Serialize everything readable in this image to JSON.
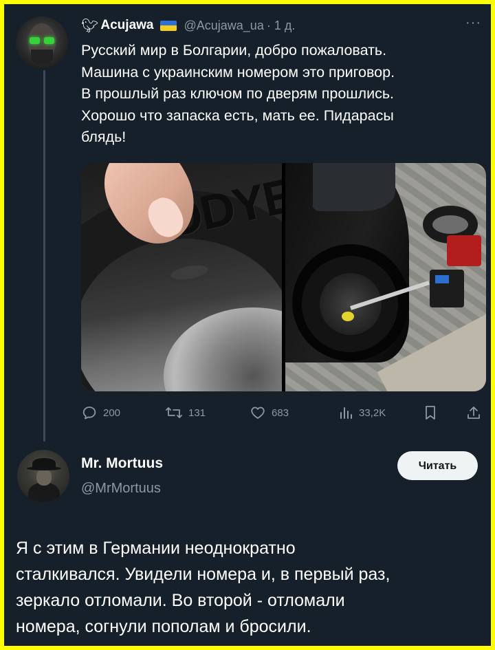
{
  "tweet": {
    "author_name": "Acujawa",
    "author_handle": "@Acujawa_ua",
    "timestamp": "· 1 д.",
    "more": "···",
    "text_lines": [
      "Русский мир в Болгарии, добро пожаловать.",
      "Машина с украинским номером это приговор.",
      "В прошлый раз ключом по дверям прошлись.",
      "Хорошо что запаска есть, мать ее. Пидарасы",
      "блядь!"
    ],
    "tyre_letters": "ODYEA",
    "actions": {
      "replies": "200",
      "retweets": "131",
      "likes": "683",
      "views": "33,2K"
    }
  },
  "reply_account": {
    "name": "Mr. Mortuus",
    "handle": "@MrMortuus",
    "follow_label": "Читать"
  },
  "reply": {
    "text_lines": [
      "Я с этим в Германии неоднократно",
      "сталкивался. Увидели номера и, в первый раз,",
      "зеркало отломали. Во второй - отломали",
      "номера, согнули пополам и бросили."
    ]
  },
  "icons": {
    "bird": "bird-icon",
    "flag": "ukraine-flag-icon",
    "reply": "reply-icon",
    "retweet": "retweet-icon",
    "like": "heart-icon",
    "views": "views-icon",
    "bookmark": "bookmark-icon",
    "share": "share-icon"
  },
  "colors": {
    "background": "#15202b",
    "border": "#ffff00",
    "secondary_text": "#8b98a5",
    "button_bg": "#eff3f4"
  }
}
